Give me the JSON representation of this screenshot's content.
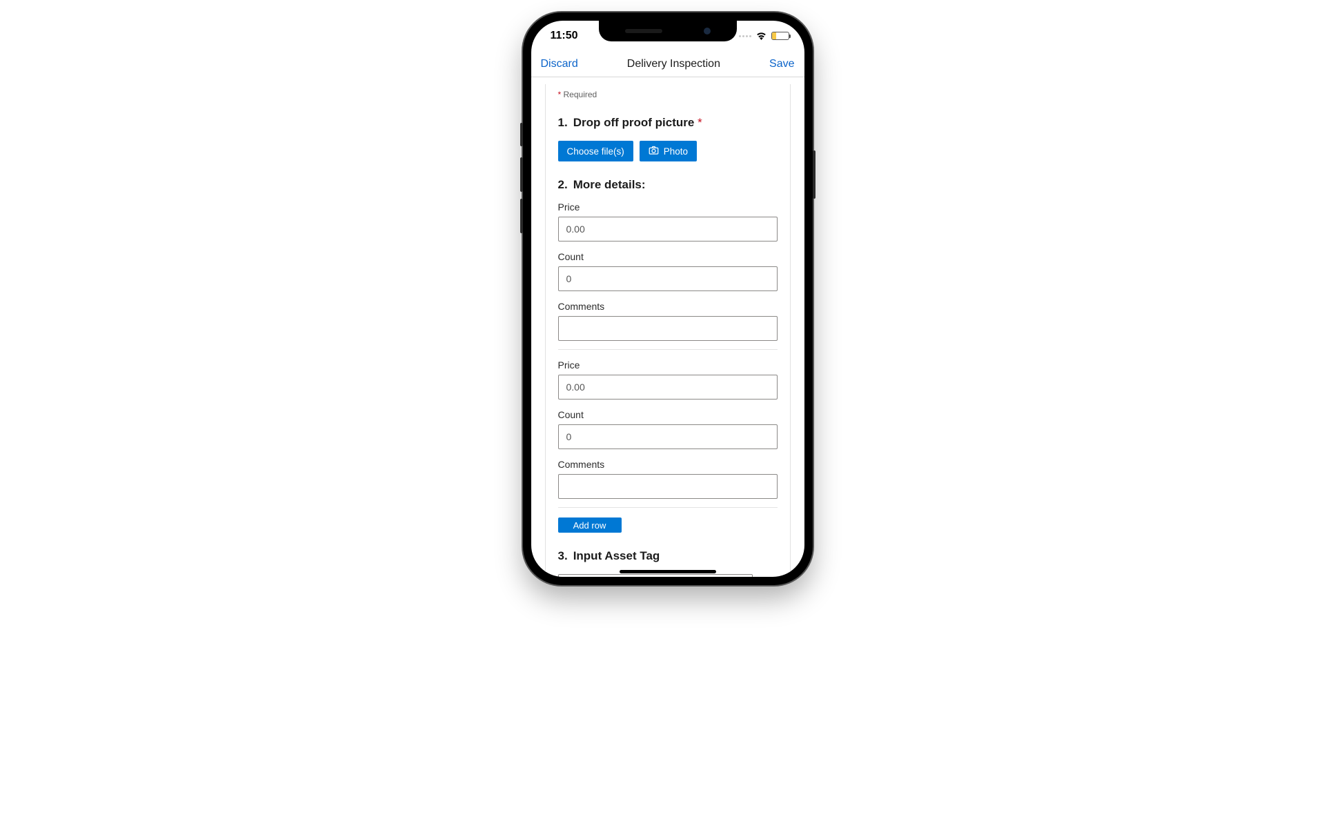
{
  "statusBar": {
    "time": "11:50"
  },
  "nav": {
    "discard": "Discard",
    "title": "Delivery Inspection",
    "save": "Save"
  },
  "requiredNote": "Required",
  "q1": {
    "number": "1.",
    "text": "Drop off proof picture",
    "chooseFiles": "Choose file(s)",
    "photo": "Photo"
  },
  "q2": {
    "number": "2.",
    "text": "More details:",
    "rows": [
      {
        "priceLabel": "Price",
        "priceValue": "0.00",
        "countLabel": "Count",
        "countValue": "0",
        "commentsLabel": "Comments",
        "commentsValue": ""
      },
      {
        "priceLabel": "Price",
        "priceValue": "0.00",
        "countLabel": "Count",
        "countValue": "0",
        "commentsLabel": "Comments",
        "commentsValue": ""
      }
    ],
    "addRow": "Add row"
  },
  "q3": {
    "number": "3.",
    "text": "Input Asset Tag",
    "value": ""
  }
}
